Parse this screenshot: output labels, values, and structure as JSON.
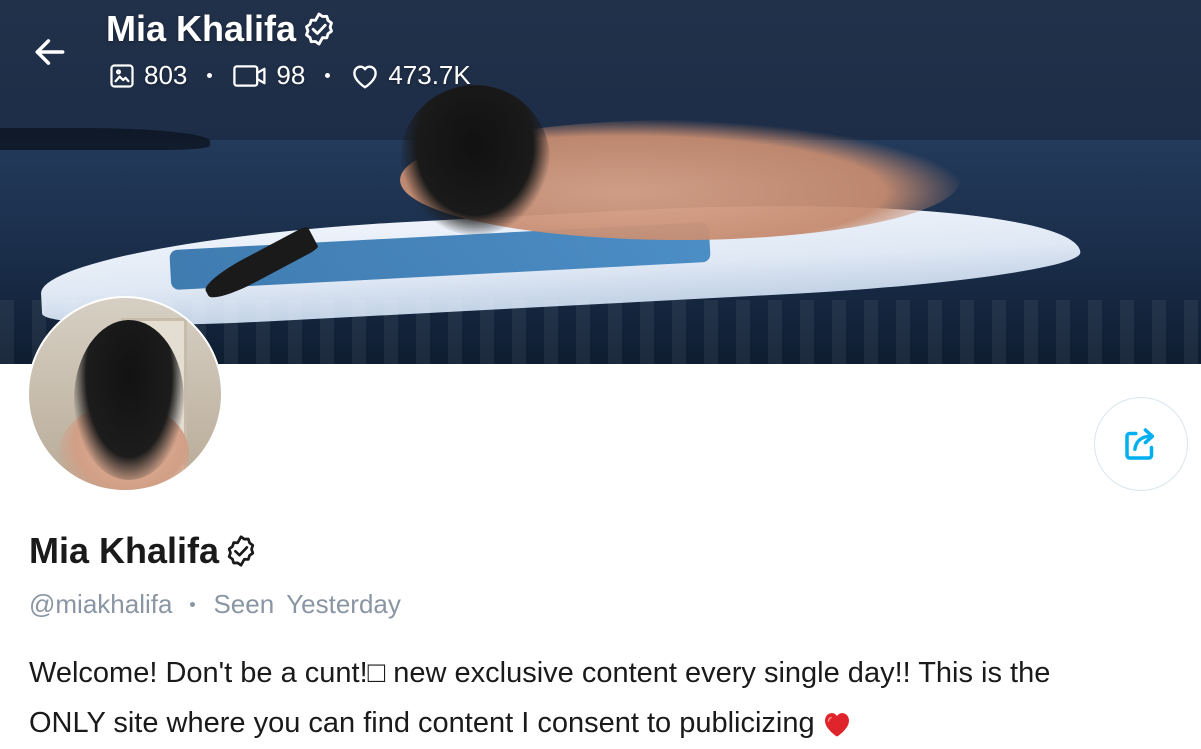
{
  "header": {
    "name": "Mia Khalifa",
    "stats": {
      "photos": "803",
      "videos": "98",
      "likes": "473.7K"
    }
  },
  "profile": {
    "name": "Mia Khalifa",
    "handle": "@miakhalifa",
    "seen_label": "Seen",
    "seen_value": "Yesterday",
    "bio_line1": "Welcome! Don't be a cunt!□ new exclusive content every single day!! This is the",
    "bio_line2": "ONLY site where you can find content I consent to publicizing"
  },
  "icons": {
    "back": "arrow-left-icon",
    "verified": "verified-badge-icon",
    "photos": "image-icon",
    "videos": "video-camera-icon",
    "likes": "heart-outline-icon",
    "share": "share-icon",
    "bio_emoji": "red-heart-icon"
  },
  "colors": {
    "accent": "#00aff0",
    "muted_text": "#8a96a3",
    "text": "#1a1a1a",
    "heart": "#e0242b"
  }
}
